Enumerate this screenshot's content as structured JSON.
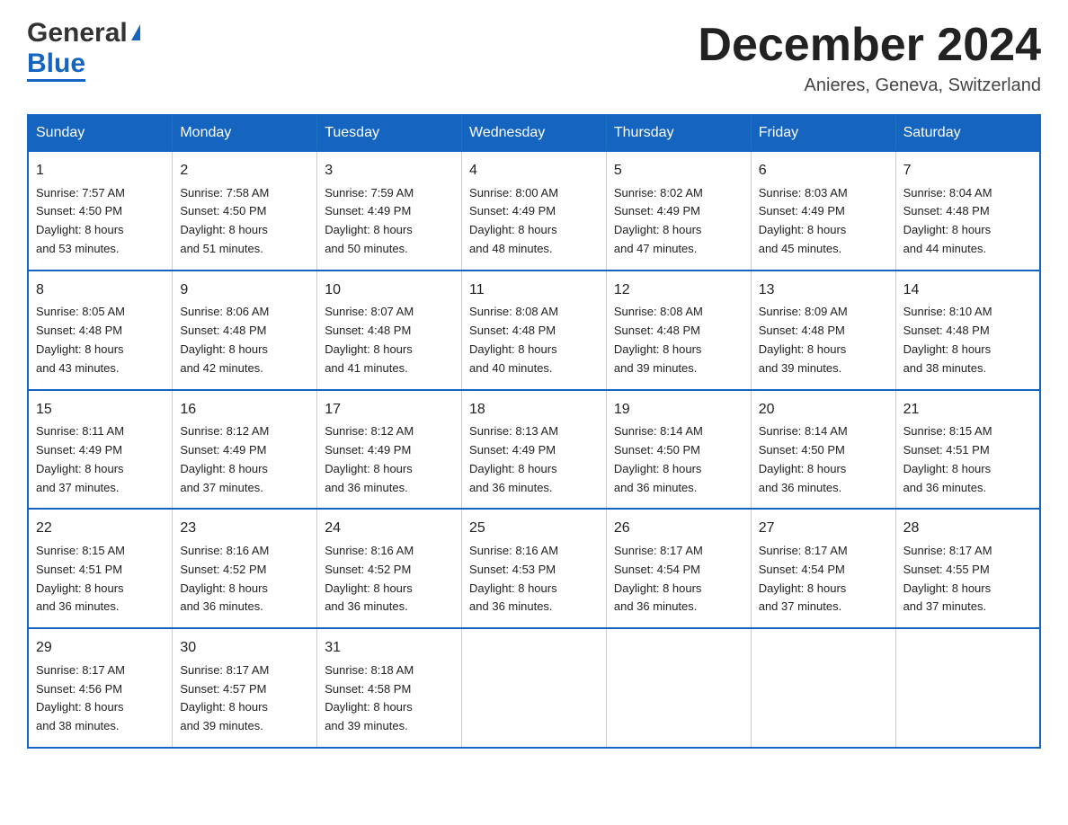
{
  "header": {
    "logo": {
      "general": "General",
      "blue": "Blue",
      "tagline": ""
    },
    "title": "December 2024",
    "location": "Anieres, Geneva, Switzerland"
  },
  "calendar": {
    "days_of_week": [
      "Sunday",
      "Monday",
      "Tuesday",
      "Wednesday",
      "Thursday",
      "Friday",
      "Saturday"
    ],
    "weeks": [
      [
        {
          "day": "1",
          "sunrise": "7:57 AM",
          "sunset": "4:50 PM",
          "daylight": "8 hours and 53 minutes."
        },
        {
          "day": "2",
          "sunrise": "7:58 AM",
          "sunset": "4:50 PM",
          "daylight": "8 hours and 51 minutes."
        },
        {
          "day": "3",
          "sunrise": "7:59 AM",
          "sunset": "4:49 PM",
          "daylight": "8 hours and 50 minutes."
        },
        {
          "day": "4",
          "sunrise": "8:00 AM",
          "sunset": "4:49 PM",
          "daylight": "8 hours and 48 minutes."
        },
        {
          "day": "5",
          "sunrise": "8:02 AM",
          "sunset": "4:49 PM",
          "daylight": "8 hours and 47 minutes."
        },
        {
          "day": "6",
          "sunrise": "8:03 AM",
          "sunset": "4:49 PM",
          "daylight": "8 hours and 45 minutes."
        },
        {
          "day": "7",
          "sunrise": "8:04 AM",
          "sunset": "4:48 PM",
          "daylight": "8 hours and 44 minutes."
        }
      ],
      [
        {
          "day": "8",
          "sunrise": "8:05 AM",
          "sunset": "4:48 PM",
          "daylight": "8 hours and 43 minutes."
        },
        {
          "day": "9",
          "sunrise": "8:06 AM",
          "sunset": "4:48 PM",
          "daylight": "8 hours and 42 minutes."
        },
        {
          "day": "10",
          "sunrise": "8:07 AM",
          "sunset": "4:48 PM",
          "daylight": "8 hours and 41 minutes."
        },
        {
          "day": "11",
          "sunrise": "8:08 AM",
          "sunset": "4:48 PM",
          "daylight": "8 hours and 40 minutes."
        },
        {
          "day": "12",
          "sunrise": "8:08 AM",
          "sunset": "4:48 PM",
          "daylight": "8 hours and 39 minutes."
        },
        {
          "day": "13",
          "sunrise": "8:09 AM",
          "sunset": "4:48 PM",
          "daylight": "8 hours and 39 minutes."
        },
        {
          "day": "14",
          "sunrise": "8:10 AM",
          "sunset": "4:48 PM",
          "daylight": "8 hours and 38 minutes."
        }
      ],
      [
        {
          "day": "15",
          "sunrise": "8:11 AM",
          "sunset": "4:49 PM",
          "daylight": "8 hours and 37 minutes."
        },
        {
          "day": "16",
          "sunrise": "8:12 AM",
          "sunset": "4:49 PM",
          "daylight": "8 hours and 37 minutes."
        },
        {
          "day": "17",
          "sunrise": "8:12 AM",
          "sunset": "4:49 PM",
          "daylight": "8 hours and 36 minutes."
        },
        {
          "day": "18",
          "sunrise": "8:13 AM",
          "sunset": "4:49 PM",
          "daylight": "8 hours and 36 minutes."
        },
        {
          "day": "19",
          "sunrise": "8:14 AM",
          "sunset": "4:50 PM",
          "daylight": "8 hours and 36 minutes."
        },
        {
          "day": "20",
          "sunrise": "8:14 AM",
          "sunset": "4:50 PM",
          "daylight": "8 hours and 36 minutes."
        },
        {
          "day": "21",
          "sunrise": "8:15 AM",
          "sunset": "4:51 PM",
          "daylight": "8 hours and 36 minutes."
        }
      ],
      [
        {
          "day": "22",
          "sunrise": "8:15 AM",
          "sunset": "4:51 PM",
          "daylight": "8 hours and 36 minutes."
        },
        {
          "day": "23",
          "sunrise": "8:16 AM",
          "sunset": "4:52 PM",
          "daylight": "8 hours and 36 minutes."
        },
        {
          "day": "24",
          "sunrise": "8:16 AM",
          "sunset": "4:52 PM",
          "daylight": "8 hours and 36 minutes."
        },
        {
          "day": "25",
          "sunrise": "8:16 AM",
          "sunset": "4:53 PM",
          "daylight": "8 hours and 36 minutes."
        },
        {
          "day": "26",
          "sunrise": "8:17 AM",
          "sunset": "4:54 PM",
          "daylight": "8 hours and 36 minutes."
        },
        {
          "day": "27",
          "sunrise": "8:17 AM",
          "sunset": "4:54 PM",
          "daylight": "8 hours and 37 minutes."
        },
        {
          "day": "28",
          "sunrise": "8:17 AM",
          "sunset": "4:55 PM",
          "daylight": "8 hours and 37 minutes."
        }
      ],
      [
        {
          "day": "29",
          "sunrise": "8:17 AM",
          "sunset": "4:56 PM",
          "daylight": "8 hours and 38 minutes."
        },
        {
          "day": "30",
          "sunrise": "8:17 AM",
          "sunset": "4:57 PM",
          "daylight": "8 hours and 39 minutes."
        },
        {
          "day": "31",
          "sunrise": "8:18 AM",
          "sunset": "4:58 PM",
          "daylight": "8 hours and 39 minutes."
        },
        null,
        null,
        null,
        null
      ]
    ],
    "labels": {
      "sunrise": "Sunrise: ",
      "sunset": "Sunset: ",
      "daylight": "Daylight: "
    }
  }
}
